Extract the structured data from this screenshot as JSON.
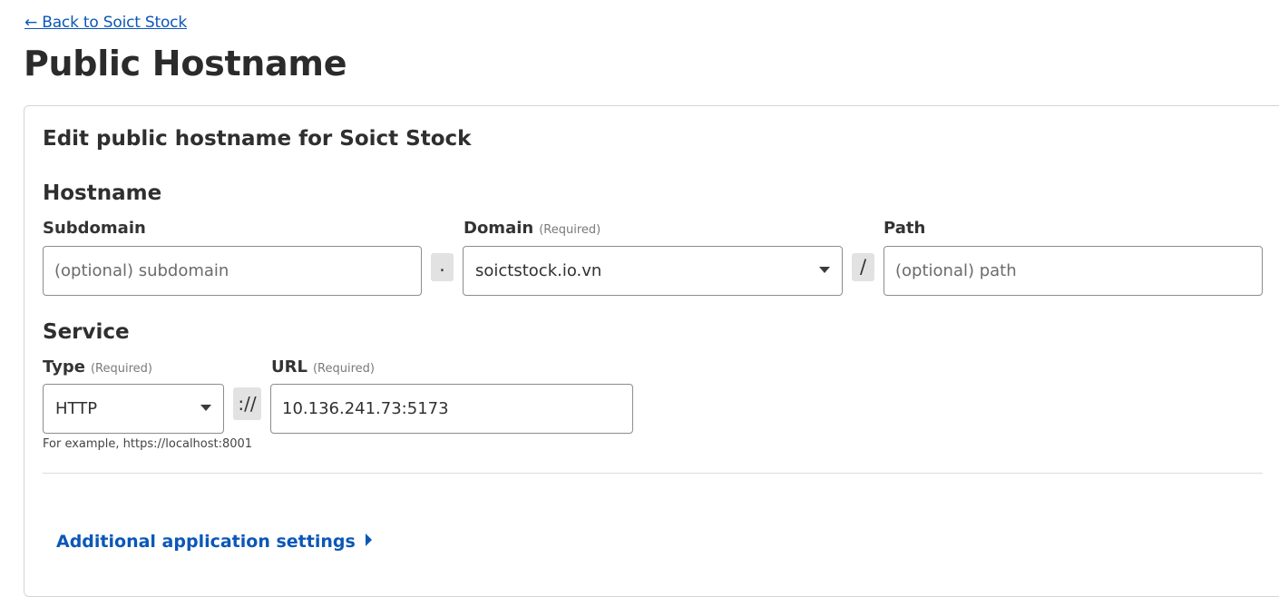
{
  "back_link": "← Back to Soict Stock",
  "page_title": "Public Hostname",
  "card_title": "Edit public hostname for Soict Stock",
  "hostname": {
    "section_title": "Hostname",
    "subdomain": {
      "label": "Subdomain",
      "placeholder": "(optional) subdomain",
      "value": ""
    },
    "dot_separator": ".",
    "domain": {
      "label": "Domain",
      "required": "(Required)",
      "value": "soictstock.io.vn"
    },
    "slash_separator": "/",
    "path": {
      "label": "Path",
      "placeholder": "(optional) path",
      "value": ""
    }
  },
  "service": {
    "section_title": "Service",
    "type": {
      "label": "Type",
      "required": "(Required)",
      "value": "HTTP"
    },
    "scheme_separator": "://",
    "url": {
      "label": "URL",
      "required": "(Required)",
      "value": "10.136.241.73:5173"
    },
    "help_text": "For example, https://localhost:8001"
  },
  "additional_settings": "Additional application settings",
  "icons": {
    "dropdown": "caret-down-icon",
    "expand": "caret-right-icon"
  },
  "colors": {
    "link": "#0b57b8",
    "separator_bg": "#e2e2e2",
    "border": "#8c8c8c"
  }
}
